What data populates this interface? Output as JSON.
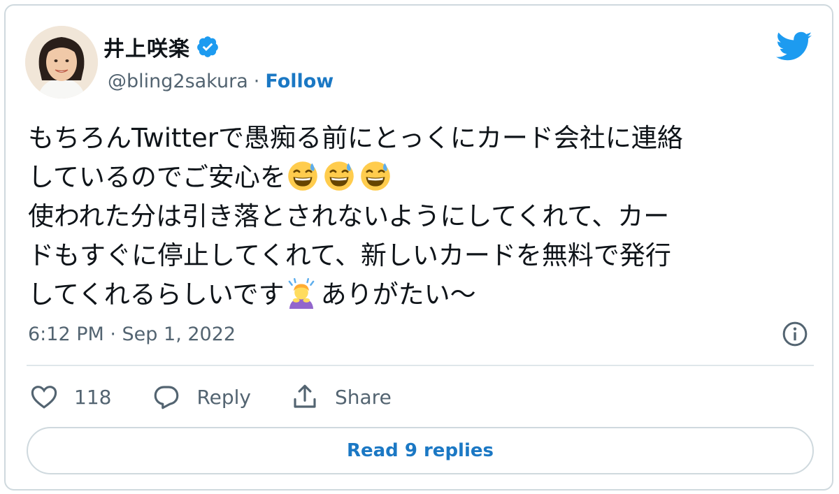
{
  "author": {
    "name": "井上咲楽",
    "handle": "@bling2sakura",
    "separator": "·",
    "follow_label": "Follow",
    "verified": true
  },
  "tweet": {
    "lines": [
      "もちろんTwitterで愚痴る前にとっくにカード会社に連絡",
      "しているのでご安心を",
      "使われた分は引き落とされないようにしてくれて、カー",
      "ドもすぐに停止してくれて、新しいカードを無料で発行",
      "してくれるらしいです",
      "ありがたい〜"
    ],
    "emoji": [
      "sweat-smile-emoji",
      "sweat-smile-emoji",
      "sweat-smile-emoji",
      "person-bowing-emoji"
    ]
  },
  "timestamp": "6:12 PM · Sep 1, 2022",
  "actions": {
    "like_count": "118",
    "reply_label": "Reply",
    "share_label": "Share"
  },
  "read_replies_label": "Read 9 replies",
  "colors": {
    "twitter_blue": "#1d9bf0",
    "link_blue": "#1b78c4",
    "text_primary": "#0f1419",
    "text_secondary": "#536471",
    "border": "#cfd9de"
  }
}
